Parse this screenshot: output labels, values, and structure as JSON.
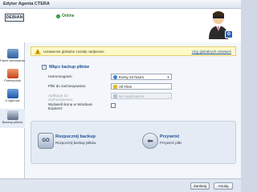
{
  "window": {
    "title": "Edytor Agenta CTERA"
  },
  "header": {
    "brand": "DEBIAN",
    "brand_sub": "",
    "status": "Online"
  },
  "sidebar": {
    "items": [
      {
        "label": "Panel sterowania",
        "icon": "dashboard-icon"
      },
      {
        "label": "Przewodnik",
        "icon": "guide-icon"
      },
      {
        "label": "O Agencie",
        "icon": "info-icon"
      },
      {
        "label": "Backup plików",
        "icon": "backup-icon"
      }
    ]
  },
  "notice": {
    "text": "Ustawienia globalne zostały nadpisane",
    "link": "Użyj globalnych ustawień"
  },
  "backup": {
    "enable_label": "Włącz backup plików",
    "schedule_label": "Harmonogram:",
    "schedule_value": "Every 24 hours",
    "files_label": "Pliki do zachowywania:",
    "files_value": "All Files",
    "apps_label": "Aplikacje do zachowywania:",
    "apps_value": "No Applications",
    "show_icon_label": "Wyświetl ikonę w Windows Explorer:"
  },
  "actions": {
    "start": {
      "title": "Rozpocznij backup",
      "desc": "Rozpocznij backup plików"
    },
    "browse": {
      "title": "Przywróć",
      "desc": "Przywróć pliki"
    }
  },
  "footer": {
    "close": "Zamknij",
    "cancel": "Anuluj"
  },
  "colors": {
    "accent": "#1d4f96",
    "online": "#3bb54a",
    "notice_bg": "#fff9c8"
  }
}
